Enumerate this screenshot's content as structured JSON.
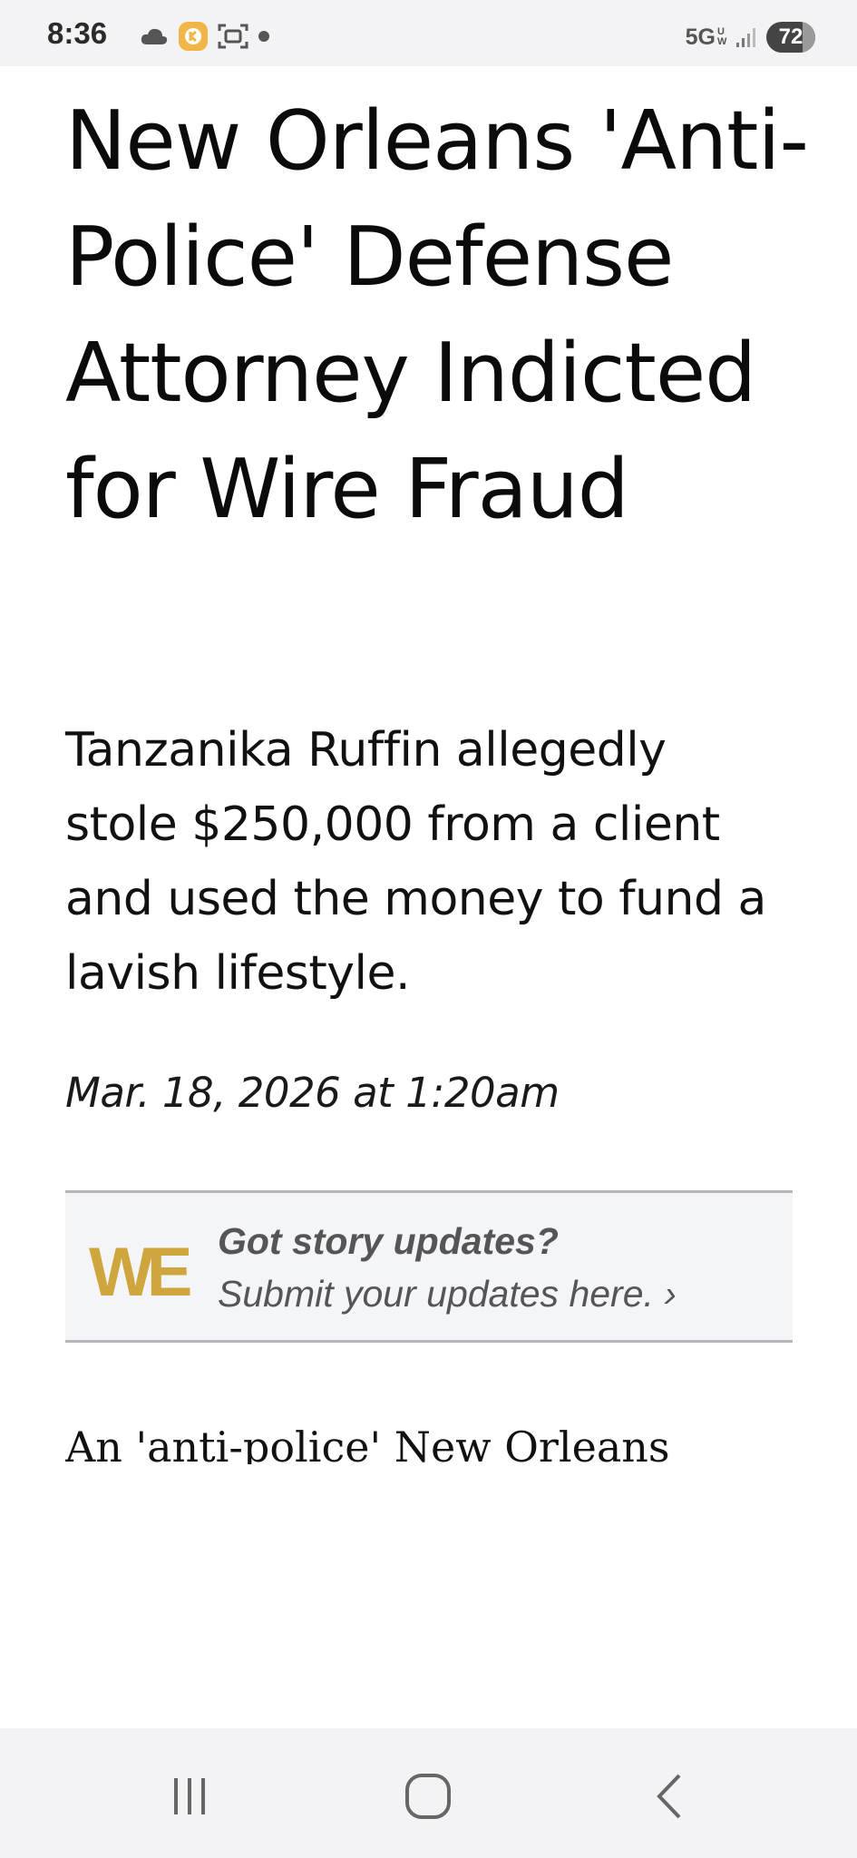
{
  "status_bar": {
    "time": "8:36",
    "network": "5G",
    "network_sub": "UW",
    "battery": "72",
    "icons": [
      "cloud-icon",
      "app-notification-icon",
      "screenshot-icon",
      "dot-icon",
      "signal-icon"
    ]
  },
  "article": {
    "headline": "New Orleans 'Anti-Police' Defense Attorney Indicted for Wire Fraud",
    "dek": "Tanzanika Ruffin allegedly stole $250,000 from a client and used the money to fund a lavish lifestyle.",
    "dateline": "Mar. 18, 2026 at 1:20am",
    "body_start": "An 'anti-police' New Orleans"
  },
  "updates_box": {
    "logo": "WE",
    "title": "Got story updates?",
    "link": "Submit your updates here. ›",
    "logo_color": "#cfa63d"
  },
  "nav_bar": {
    "buttons": [
      "recent-apps",
      "home",
      "back"
    ]
  }
}
